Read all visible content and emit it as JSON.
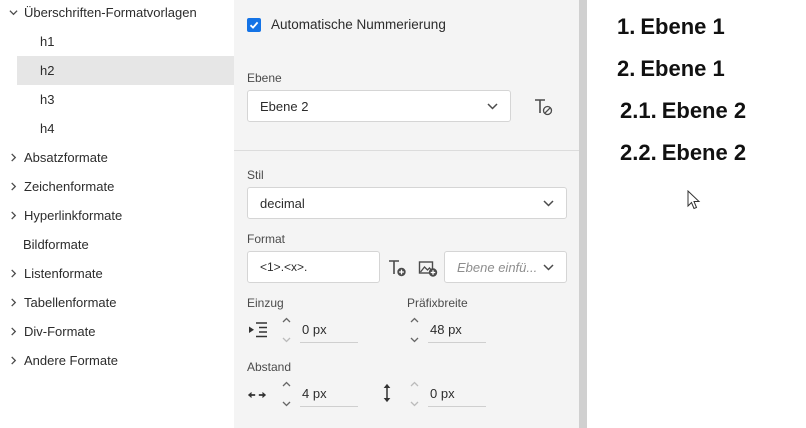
{
  "tree": {
    "items": [
      {
        "label": "Überschriften-Formatvorlagen",
        "expanded": true
      },
      {
        "label": "h1"
      },
      {
        "label": "h2",
        "selected": true
      },
      {
        "label": "h3"
      },
      {
        "label": "h4"
      },
      {
        "label": "Absatzformate"
      },
      {
        "label": "Zeichenformate"
      },
      {
        "label": "Hyperlinkformate"
      },
      {
        "label": "Bildformate"
      },
      {
        "label": "Listenformate"
      },
      {
        "label": "Tabellenformate"
      },
      {
        "label": "Div-Formate"
      },
      {
        "label": "Andere Formate"
      }
    ]
  },
  "panel": {
    "auto_numbering_label": "Automatische Nummerierung",
    "auto_numbering_checked": true,
    "ebene_label": "Ebene",
    "ebene_value": "Ebene 2",
    "stil_label": "Stil",
    "stil_value": "decimal",
    "format_label": "Format",
    "format_value": "<1>.<x>.",
    "insert_level_placeholder": "Ebene einfü...",
    "einzug_label": "Einzug",
    "einzug_value": "0 px",
    "praefix_label": "Präfixbreite",
    "praefix_value": "48 px",
    "abstand_label": "Abstand",
    "abstand_h_value": "4 px",
    "abstand_v_value": "0 px",
    "accent_color": "#1473e6"
  },
  "preview": {
    "lines": [
      {
        "num": "1.",
        "text": "Ebene 1"
      },
      {
        "num": "2.",
        "text": "Ebene 1"
      },
      {
        "num": "2.1.",
        "text": "Ebene 2"
      },
      {
        "num": "2.2.",
        "text": "Ebene 2"
      }
    ]
  }
}
